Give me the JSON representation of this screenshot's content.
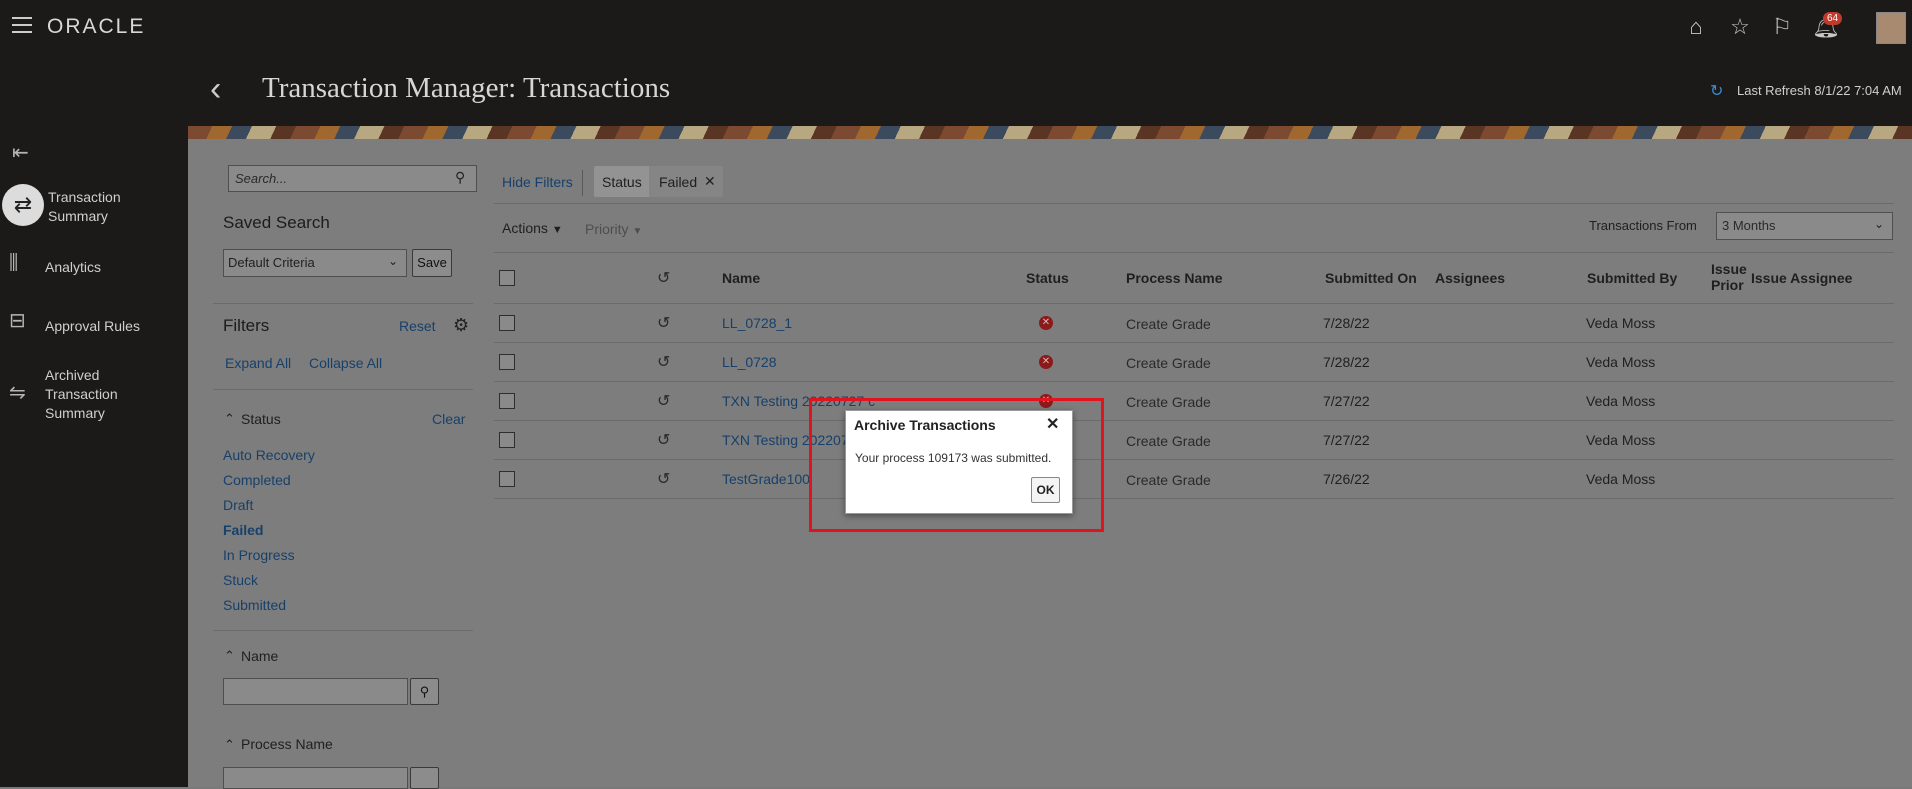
{
  "app": {
    "logo": "ORACLE",
    "notif_count": "64"
  },
  "nav": {
    "items": [
      {
        "label": "Transaction Summary",
        "icon": "arrows-swap-icon"
      },
      {
        "label": "Analytics",
        "icon": "chart-icon"
      },
      {
        "label": "Approval Rules",
        "icon": "approval-rules-icon"
      },
      {
        "label": "Archived Transaction Summary",
        "icon": "archive-arrows-icon"
      }
    ]
  },
  "header": {
    "title": "Transaction Manager: Transactions",
    "last_refresh": "Last Refresh 8/1/22 7:04 AM"
  },
  "search": {
    "placeholder": "Search..."
  },
  "saved_search": {
    "title": "Saved Search",
    "value": "Default Criteria",
    "save_label": "Save"
  },
  "filters": {
    "title": "Filters",
    "reset_label": "Reset",
    "expand_all": "Expand All",
    "collapse_all": "Collapse All",
    "status_header": "Status",
    "clear_label": "Clear",
    "status_options": [
      "Auto Recovery",
      "Completed",
      "Draft",
      "Failed",
      "In Progress",
      "Stuck",
      "Submitted"
    ],
    "name_header": "Name",
    "process_name_header": "Process Name"
  },
  "toolbar": {
    "hide_filters": "Hide Filters",
    "chip_status": "Status",
    "chip_value": "Failed",
    "actions": "Actions",
    "priority": "Priority",
    "transactions_from_label": "Transactions From",
    "transactions_from_value": "3 Months"
  },
  "table": {
    "headers": {
      "name": "Name",
      "status": "Status",
      "process_name": "Process Name",
      "submitted_on": "Submitted On",
      "assignees": "Assignees",
      "submitted_by": "Submitted By",
      "issue_prior": "Issue Prior",
      "issue_assignee": "Issue Assignee"
    },
    "rows": [
      {
        "name": "LL_0728_1",
        "process": "Create Grade",
        "submitted_on": "7/28/22",
        "submitted_by": "Veda Moss"
      },
      {
        "name": "LL_0728",
        "process": "Create Grade",
        "submitted_on": "7/28/22",
        "submitted_by": "Veda Moss"
      },
      {
        "name": "TXN Testing 20220727 c",
        "process": "Create Grade",
        "submitted_on": "7/27/22",
        "submitted_by": "Veda Moss"
      },
      {
        "name": "TXN Testing 202207",
        "process": "Create Grade",
        "submitted_on": "7/27/22",
        "submitted_by": "Veda Moss"
      },
      {
        "name": "TestGrade100",
        "process": "Create Grade",
        "submitted_on": "7/26/22",
        "submitted_by": "Veda Moss"
      }
    ]
  },
  "dialog": {
    "title": "Archive Transactions",
    "message": "Your process 109173 was submitted.",
    "ok_label": "OK"
  }
}
